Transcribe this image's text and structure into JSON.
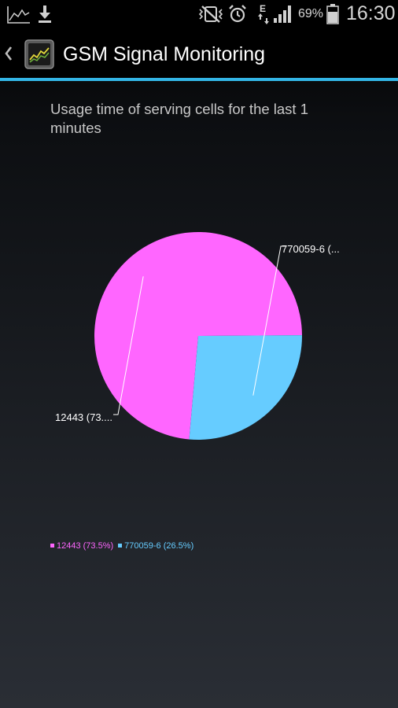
{
  "status_bar": {
    "battery_text": "69%",
    "time": "16:30",
    "network_type": "E",
    "icons": [
      "chart-notification-icon",
      "download-icon",
      "vibrate-mute-icon",
      "alarm-icon",
      "data-transfer-icon",
      "signal-icon",
      "battery-icon"
    ]
  },
  "action_bar": {
    "title": "GSM Signal Monitoring",
    "back_icon": "chevron-left-icon",
    "app_icon": "signal-chart-app-icon",
    "accent_color": "#33b5e5"
  },
  "chart_data": {
    "type": "pie",
    "title": "Usage time of serving cells for the last 1 minutes",
    "slices": [
      {
        "label": "12443",
        "value": 73.5,
        "color": "#ff66ff",
        "callout": "12443 (73....",
        "legend": "12443 (73.5%)"
      },
      {
        "label": "770059-6",
        "value": 26.5,
        "color": "#66ccff",
        "callout": "770059-6 (...",
        "legend": "770059-6 (26.5%)"
      }
    ],
    "legend_position": "bottom-left"
  }
}
